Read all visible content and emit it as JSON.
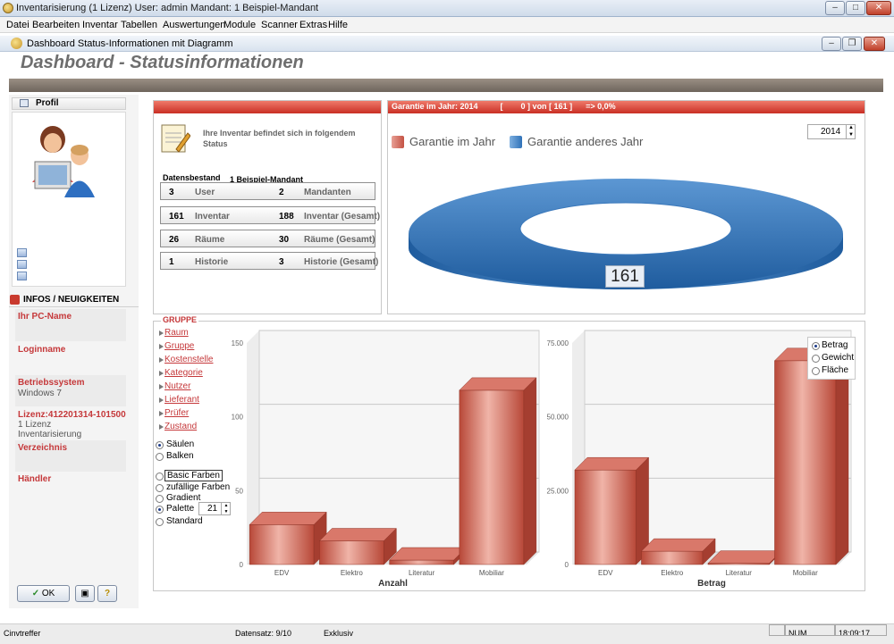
{
  "window": {
    "title": "Inventarisierung  (1 Lizenz)   User: admin   Mandant: 1 Beispiel-Mandant"
  },
  "menu": [
    "Datei",
    "Bearbeiten",
    "Inventar",
    "Tabellen",
    "Auswertungen",
    "Module",
    "Scanner",
    "Extras",
    "Hilfe"
  ],
  "inner_window": {
    "title": "Dashboard Status-Informationen mit Diagramm"
  },
  "dashboard_title": "Dashboard  - Statusinformationen",
  "sidebar": {
    "profile_label": "Profil",
    "infos_label": "INFOS / NEUIGKEITEN",
    "items": [
      {
        "label": "Ihr PC-Name",
        "value": ""
      },
      {
        "label": "Loginname",
        "value": ""
      },
      {
        "label": "Betriebssystem",
        "value": "Windows 7"
      },
      {
        "label": "Lizenz:412201314-101500",
        "value": "1 Lizenz",
        "value2": "Inventarisierung"
      },
      {
        "label": "Verzeichnis",
        "value": ""
      },
      {
        "label": "Händler",
        "value": ""
      }
    ],
    "ok_label": "OK"
  },
  "status": {
    "intro": "Ihre Inventar befindet sich in folgendem Status",
    "datensbestand_label": "Datensbestand",
    "mandant_name": "1 Beispiel-Mandant",
    "rows": [
      {
        "n1": "3",
        "l1": "User",
        "n2": "2",
        "l2": "Mandanten"
      },
      {
        "n1": "161",
        "l1": "Inventar",
        "n2": "188",
        "l2": "Inventar (Gesamt)"
      },
      {
        "n1": "26",
        "l1": "Räume",
        "n2": "30",
        "l2": "Räume (Gesamt)"
      },
      {
        "n1": "1",
        "l1": "Historie",
        "n2": "3",
        "l2": "Historie (Gesamt)"
      }
    ]
  },
  "garantie": {
    "header": "Garantie im Jahr: 2014          [        0 ] von [ 161 ]      => 0,0%",
    "year": "2014",
    "legend": [
      "Garantie im Jahr",
      "Garantie anderes Jahr"
    ],
    "donut_label": "161"
  },
  "gruppe": {
    "title": "GRUPPE",
    "links": [
      "Raum",
      "Gruppe",
      "Kostenstelle",
      "Kategorie",
      "Nutzer",
      "Lieferant",
      "Prüfer",
      "Zustand"
    ],
    "chart_type_options": [
      "Säulen",
      "Balken"
    ],
    "chart_type_selected": "Säulen",
    "color_options": [
      "Basic Farben",
      "zufällige Farben",
      "Gradient",
      "Palette",
      "Standard"
    ],
    "color_selected": "Palette",
    "palette_value": "21"
  },
  "chart_options": {
    "metrics": [
      "Betrag",
      "Gewicht",
      "Fläche"
    ],
    "selected": "Betrag"
  },
  "statusbar": {
    "left": "Cinvtreffer",
    "datensatz": "Datensatz: 9/10",
    "mode": "Exklusiv",
    "num": "NUM",
    "time": "18:09:17"
  },
  "colors": {
    "bar": "#c45243",
    "donut": "#2f72b8",
    "header_red": "#d13c2f",
    "label_red": "#c5383a"
  },
  "chart_data": [
    {
      "type": "bar",
      "categories": [
        "EDV",
        "Elektro",
        "Literatur",
        "Mobiliar"
      ],
      "values": [
        27,
        16,
        3,
        118
      ],
      "xlabel": "Anzahl",
      "ylabel": "",
      "ylim": [
        0,
        150
      ],
      "yticks": [
        "150",
        "100",
        "50",
        "0"
      ]
    },
    {
      "type": "bar",
      "categories": [
        "EDV",
        "Elektro",
        "Literatur",
        "Mobiliar"
      ],
      "values": [
        32000,
        4500,
        400,
        69000
      ],
      "xlabel": "Betrag",
      "ylabel": "",
      "ylim": [
        0,
        75000
      ],
      "yticks": [
        "75.000",
        "50.000",
        "25.000",
        "0"
      ]
    }
  ]
}
